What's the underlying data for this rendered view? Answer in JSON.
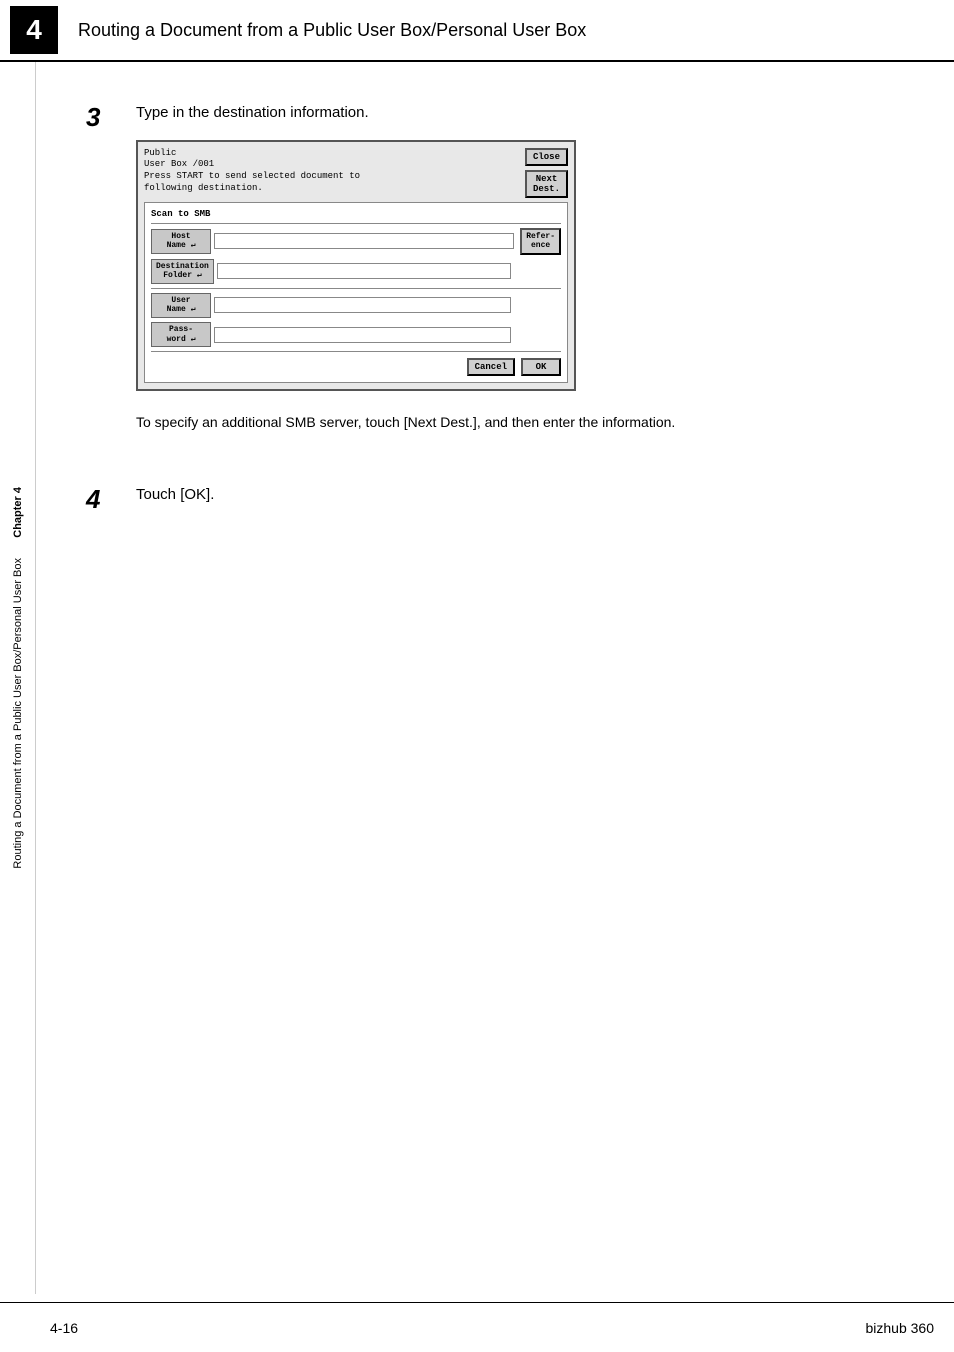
{
  "header": {
    "chapter_number": "4",
    "title": "Routing a Document from a Public User Box/Personal User Box"
  },
  "sidebar": {
    "chapter_label": "Chapter 4",
    "chapter_title": "Routing a Document from a Public User Box/Personal User Box"
  },
  "steps": [
    {
      "number": "3",
      "text": "Type in the destination information.",
      "screen": {
        "status_line1": "Public",
        "status_line2": "User Box   /001",
        "status_line3": "Press START to send selected document to",
        "status_line4": "following destination.",
        "close_btn": "Close",
        "next_dest_btn": "Next\nDest.",
        "section_label": "Scan to SMB",
        "fields": [
          {
            "label": "Host\nName",
            "has_arrow": true
          },
          {
            "label": "Destination\nFolder",
            "has_arrow": true
          },
          {
            "label": "User\nName",
            "has_arrow": true
          },
          {
            "label": "Pass-\nword",
            "has_arrow": true
          }
        ],
        "refer_btn": "Refer-\nence",
        "cancel_btn": "Cancel",
        "ok_btn": "OK"
      },
      "note": "To specify an additional SMB server, touch [Next Dest.], and then enter\nthe information."
    },
    {
      "number": "4",
      "text": "Touch [OK]."
    }
  ],
  "footer": {
    "page": "4-16",
    "brand": "bizhub 360"
  }
}
